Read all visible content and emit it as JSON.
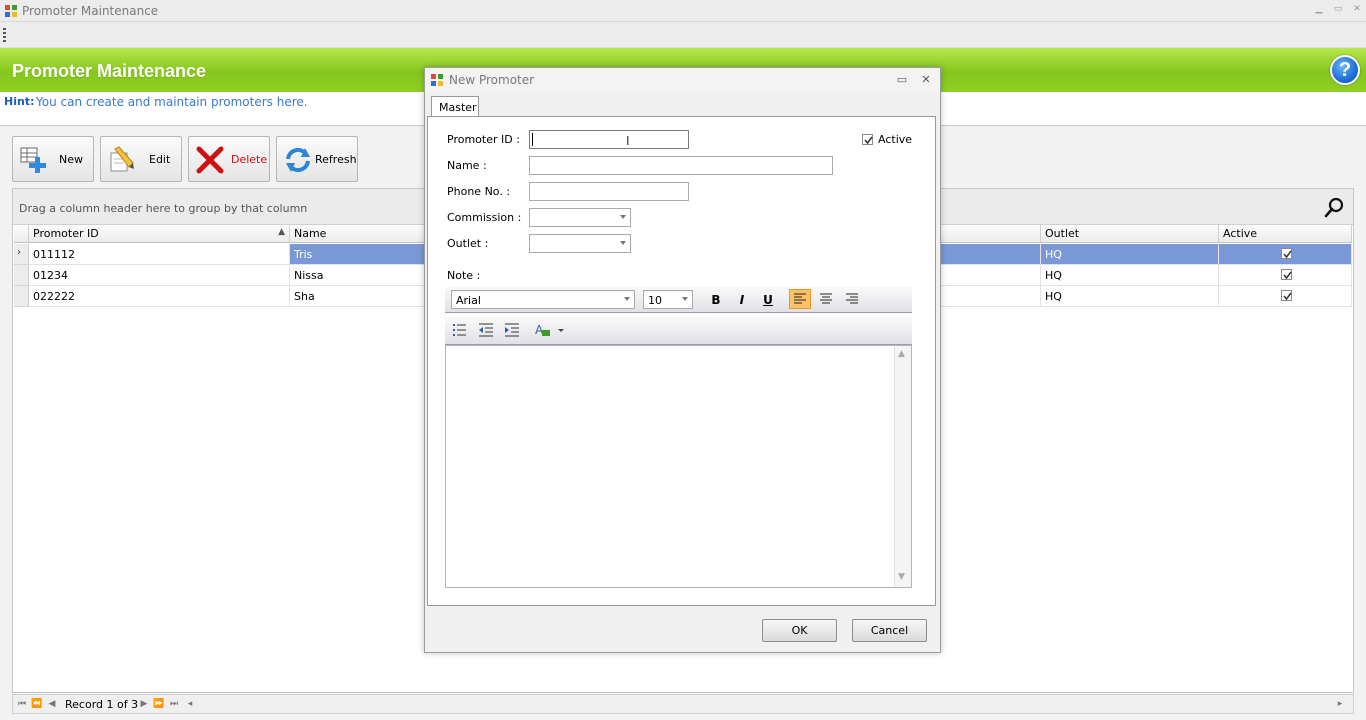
{
  "window": {
    "title": "Promoter Maintenance"
  },
  "header": {
    "title": "Promoter Maintenance",
    "help_icon": "?"
  },
  "hint": {
    "label": "Hint:",
    "text": "You can create and maintain promoters here."
  },
  "toolbar": {
    "new_label": "New",
    "edit_label": "Edit",
    "delete_label": "Delete",
    "refresh_label": "Refresh"
  },
  "grid": {
    "group_hint": "Drag a column header here to group by that column",
    "columns": {
      "promoter_id": "Promoter ID",
      "name": "Name",
      "outlet": "Outlet",
      "active": "Active"
    },
    "rows": [
      {
        "promoter_id": "011112",
        "name": "Tris",
        "outlet": "HQ",
        "active": true,
        "selected": true
      },
      {
        "promoter_id": "01234",
        "name": "Nissa",
        "outlet": "HQ",
        "active": true,
        "selected": false
      },
      {
        "promoter_id": "022222",
        "name": "Sha",
        "outlet": "HQ",
        "active": true,
        "selected": false
      }
    ]
  },
  "navbar": {
    "record_text": "Record 1 of 3"
  },
  "dialog": {
    "title": "New Promoter",
    "tab": "Master",
    "fields": {
      "promoter_id_label": "Promoter ID :",
      "promoter_id_value": "",
      "name_label": "Name :",
      "name_value": "",
      "phone_label": "Phone No. :",
      "phone_value": "",
      "commission_label": "Commission :",
      "commission_value": "",
      "outlet_label": "Outlet :",
      "outlet_value": "",
      "active_label": "Active",
      "active_checked": true,
      "note_label": "Note :"
    },
    "editor": {
      "font": "Arial",
      "size": "10",
      "bold": "B",
      "italic": "I",
      "underline": "U"
    },
    "ok_label": "OK",
    "cancel_label": "Cancel"
  },
  "colors": {
    "header_green": "#8fcf24",
    "selected_row": "#7b98d6",
    "hint_blue": "#3a79c8",
    "delete_red": "#cc1111"
  }
}
